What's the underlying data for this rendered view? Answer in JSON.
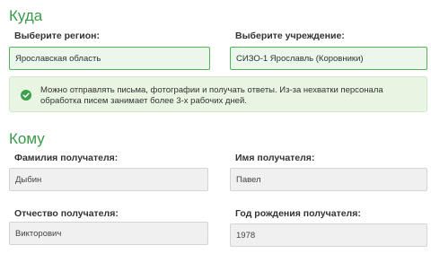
{
  "to_section": {
    "title": "Куда",
    "region_label": "Выберите регион:",
    "region_value": "Ярославская область",
    "institution_label": "Выберите учреждение:",
    "institution_value": "СИЗО-1 Ярославль (Коровники)",
    "notice": "Можно отправлять письма, фотографии и получать ответы. Из-за нехватки персонала обработка писем занимает более 3-х рабочих дней.",
    "notice_icon": "check-circle-icon"
  },
  "recipient_section": {
    "title": "Кому",
    "surname_label": "Фамилия получателя:",
    "surname_value": "Дыбин",
    "name_label": "Имя получателя:",
    "name_value": "Павел",
    "patronymic_label": "Отчество получателя:",
    "patronymic_value": "Викторович",
    "birth_year_label": "Год рождения получателя:",
    "birth_year_value": "1978"
  },
  "colors": {
    "accent": "#3a9a4a",
    "valid_border": "#52b45a",
    "valid_background": "#eaf7ea",
    "notice_background": "#e7f5e2"
  }
}
